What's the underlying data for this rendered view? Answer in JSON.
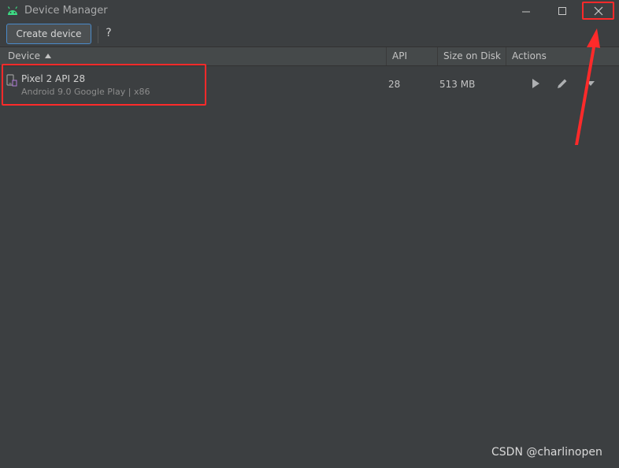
{
  "window": {
    "title": "Device Manager",
    "icons": {
      "app": "android-icon",
      "minimize": "minimize-icon",
      "maximize": "maximize-icon",
      "close": "close-icon"
    }
  },
  "toolbar": {
    "create_label": "Create device",
    "help_label": "?"
  },
  "table": {
    "columns": [
      "Device",
      "API",
      "Size on Disk",
      "Actions"
    ],
    "sorted_column": "Device",
    "sort_direction": "ascending",
    "rows": [
      {
        "name": "Pixel 2 API 28",
        "detail": "Android 9.0 Google Play | x86",
        "api": "28",
        "size": "513 MB",
        "actions": [
          "play-icon",
          "edit-icon",
          "dropdown-arrow-icon"
        ]
      }
    ]
  },
  "annotations": {
    "highlight_color": "#ff2a2a",
    "watermark": "CSDN @charlinopen"
  }
}
